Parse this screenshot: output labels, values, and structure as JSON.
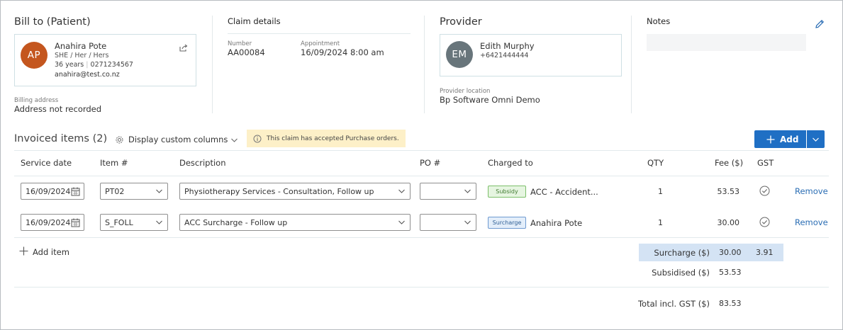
{
  "bill_to": {
    "heading": "Bill to (Patient)",
    "initials": "AP",
    "avatar_color": "#c4561e",
    "name": "Anahira Pote",
    "pronouns": "SHE / Her / Hers",
    "age": "36 years",
    "phone": "0271234567",
    "email": "anahira@test.co.nz",
    "billing_label": "Billing address",
    "billing_value": "Address not recorded"
  },
  "claim": {
    "heading": "Claim details",
    "number_label": "Number",
    "number_value": "AA00084",
    "appointment_label": "Appointment",
    "appointment_value": "16/09/2024 8:00 am"
  },
  "provider": {
    "heading": "Provider",
    "initials": "EM",
    "avatar_color": "#68757b",
    "name": "Edith Murphy",
    "phone": "+6421444444",
    "location_label": "Provider location",
    "location_value": "Bp Software Omni Demo"
  },
  "notes": {
    "heading": "Notes"
  },
  "invoiced": {
    "title": "Invoiced items (2)",
    "custom_columns": "Display custom columns",
    "notice": "This claim has accepted Purchase orders.",
    "add_label": "Add",
    "add_color": "#1f6fc4",
    "columns": {
      "service_date": "Service date",
      "item": "Item #",
      "description": "Description",
      "po": "PO #",
      "charged_to": "Charged to",
      "qty": "QTY",
      "fee": "Fee ($)",
      "gst": "GST"
    },
    "rows": [
      {
        "date": "16/09/2024",
        "item": "PT02",
        "description": "Physiotherapy Services - Consultation, Follow up",
        "po": "",
        "tag": "Subsidy",
        "charged_to": "ACC - Accident...",
        "qty": "1",
        "fee": "53.53",
        "remove": "Remove"
      },
      {
        "date": "16/09/2024",
        "item": "S_FOLL",
        "description": "ACC Surcharge - Follow up",
        "po": "",
        "tag": "Surcharge",
        "charged_to": "Anahira Pote",
        "qty": "1",
        "fee": "30.00",
        "remove": "Remove"
      }
    ],
    "add_item": "Add item"
  },
  "totals": {
    "surcharge_label": "Surcharge ($)",
    "surcharge_value": "30.00",
    "surcharge_gst": "3.91",
    "subsidised_label": "Subsidised ($)",
    "subsidised_value": "53.53",
    "total_label": "Total incl. GST ($)",
    "total_value": "83.53"
  }
}
